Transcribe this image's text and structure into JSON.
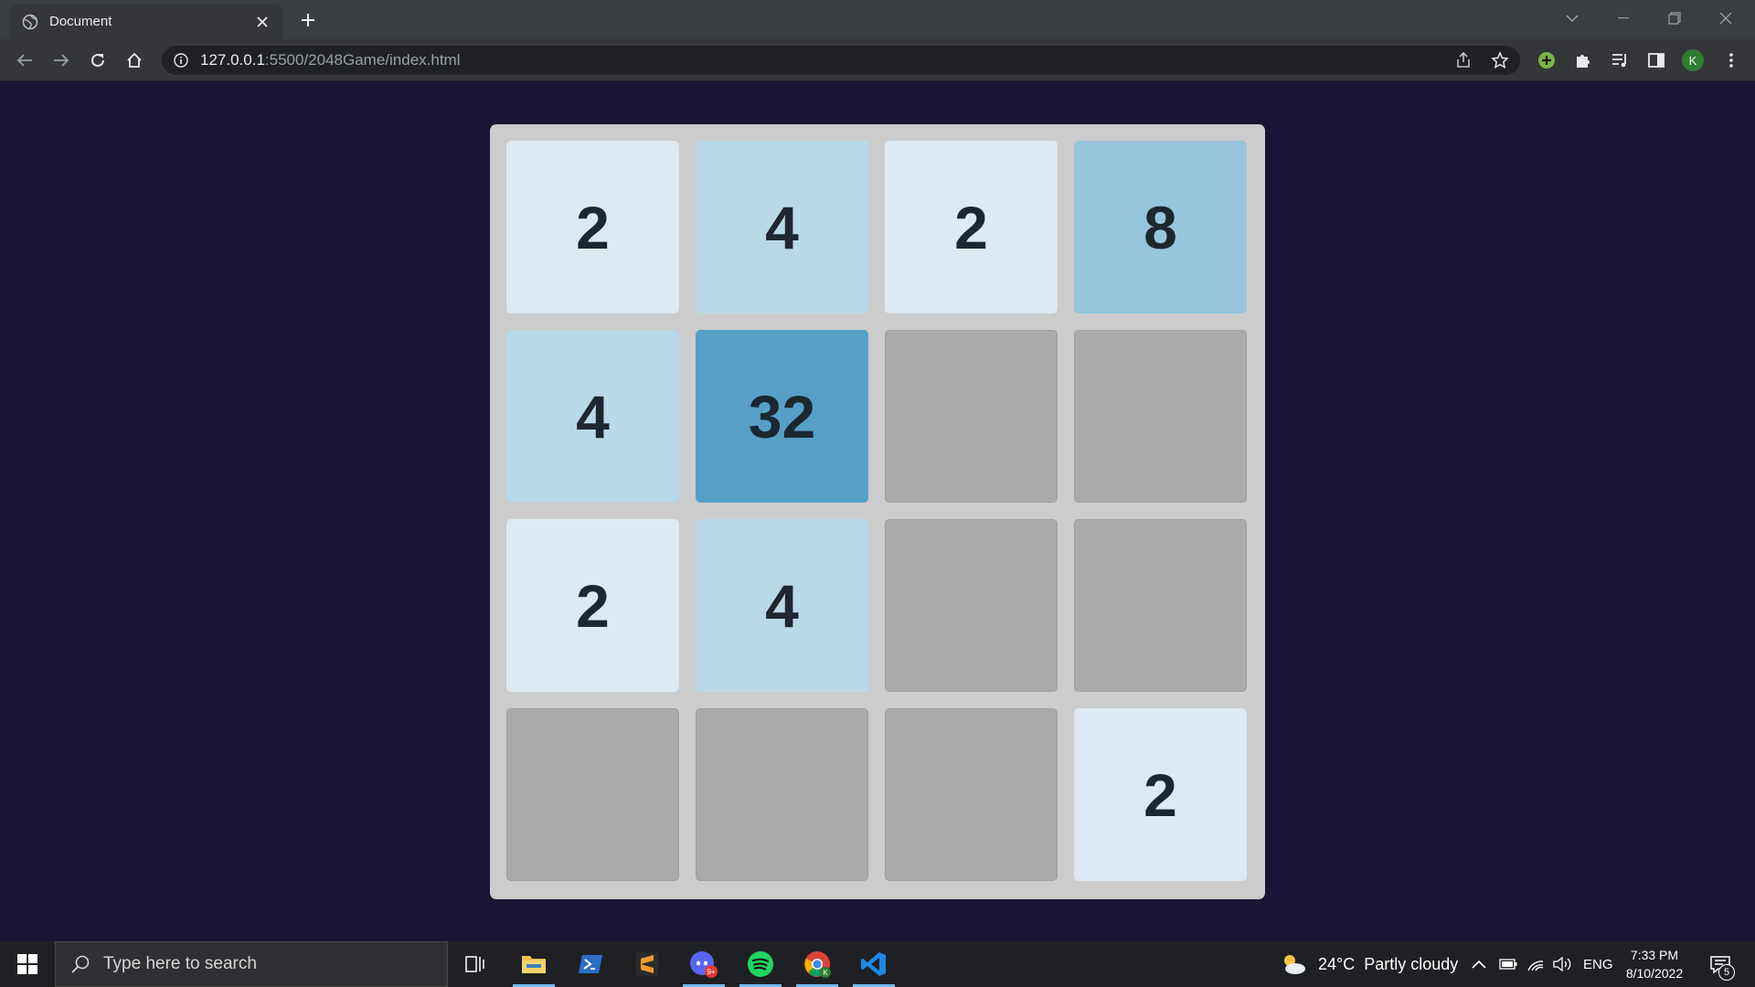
{
  "browser": {
    "tab_title": "Document",
    "url_host": "127.0.0.1",
    "url_path": ":5500/2048Game/index.html",
    "profile_initial": "K"
  },
  "game": {
    "grid": [
      [
        "2",
        "4",
        "2",
        "8"
      ],
      [
        "4",
        "32",
        "",
        ""
      ],
      [
        "2",
        "4",
        "",
        ""
      ],
      [
        "",
        "",
        "",
        "2"
      ]
    ],
    "colors": {
      "2": "#ddeaf3",
      "4": "#b9d9e8",
      "8": "#97c5dc",
      "32": "#56a0c8",
      "empty": "#aaaaaa",
      "board": "#cccccc",
      "page_bg": "#1b1436",
      "tile_text": "#1d2730"
    }
  },
  "taskbar": {
    "search_placeholder": "Type here to search",
    "discord_badge": "9+",
    "weather": "24°C  Partly cloudy",
    "language": "ENG",
    "time": "7:33 PM",
    "date": "8/10/2022",
    "notification_count": "5"
  }
}
